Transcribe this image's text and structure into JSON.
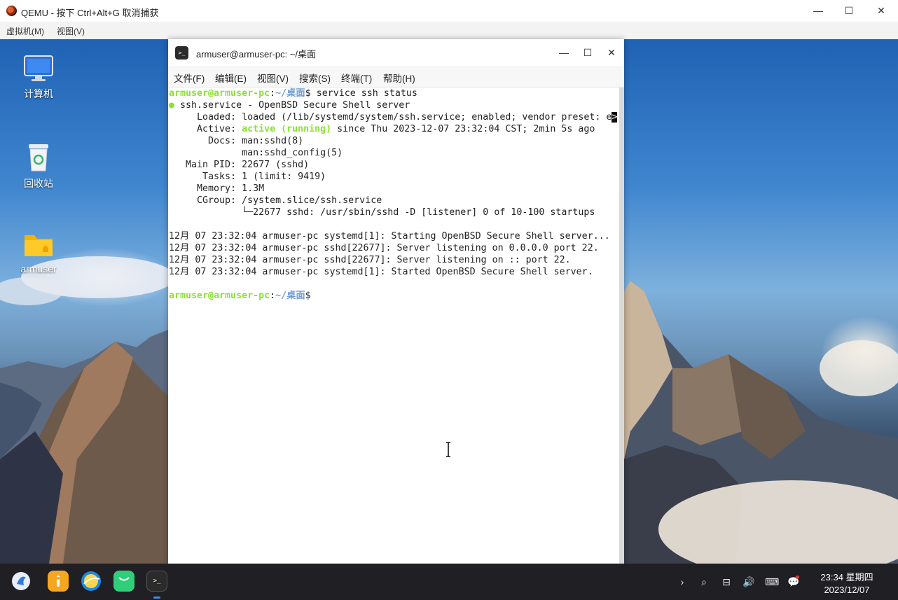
{
  "host": {
    "title": "QEMU - 按下 Ctrl+Alt+G 取消捕获",
    "menu": [
      "虚拟机(M)",
      "视图(V)"
    ],
    "controls": {
      "minimize": "—",
      "maximize": "☐",
      "close": "✕"
    }
  },
  "desktop": {
    "icons": [
      {
        "label": "计算机",
        "icon": "computer-icon"
      },
      {
        "label": "回收站",
        "icon": "trash-icon"
      },
      {
        "label": "armuser",
        "icon": "home-folder-icon"
      }
    ]
  },
  "terminal": {
    "title": "armuser@armuser-pc: ~/桌面",
    "icon_text": ">_",
    "menu": [
      "文件(F)",
      "编辑(E)",
      "视图(V)",
      "搜索(S)",
      "终端(T)",
      "帮助(H)"
    ],
    "prompt_user": "armuser@armuser-pc",
    "prompt_sep": ":",
    "prompt_path": "~/桌面",
    "prompt_end": "$",
    "command": " service ssh status",
    "lines": {
      "service_bullet": "●",
      "service": " ssh.service - OpenBSD Secure Shell server",
      "loaded": "     Loaded: loaded (/lib/systemd/system/ssh.service; enabled; vendor preset: e",
      "loaded_more": ">",
      "active_label": "     Active: ",
      "active_state": "active (running)",
      "active_rest": " since Thu 2023-12-07 23:32:04 CST; 2min 5s ago",
      "docs1": "       Docs: man:sshd(8)",
      "docs2": "             man:sshd_config(5)",
      "mainpid": "   Main PID: 22677 (sshd)",
      "tasks": "      Tasks: 1 (limit: 9419)",
      "memory": "     Memory: 1.3M",
      "cgroup": "     CGroup: /system.slice/ssh.service",
      "cgroup_child": "             └─22677 sshd: /usr/sbin/sshd -D [listener] 0 of 10-100 startups",
      "log1": "12月 07 23:32:04 armuser-pc systemd[1]: Starting OpenBSD Secure Shell server...",
      "log2": "12月 07 23:32:04 armuser-pc sshd[22677]: Server listening on 0.0.0.0 port 22.",
      "log3": "12月 07 23:32:04 armuser-pc sshd[22677]: Server listening on :: port 22.",
      "log4": "12月 07 23:32:04 armuser-pc systemd[1]: Started OpenBSD Secure Shell server."
    },
    "controls": {
      "minimize": "—",
      "maximize": "☐",
      "close": "✕"
    }
  },
  "taskbar": {
    "apps": [
      "launcher-icon",
      "app-store-icon",
      "browser-icon",
      "chat-icon",
      "terminal-icon"
    ],
    "terminal_icon_text": ">_",
    "tray": {
      "expand": "›",
      "search": "⌕",
      "network": "⊟",
      "volume": "🔊",
      "keyboard": "⌨",
      "notifications": "💬"
    },
    "clock_time": "23:34 星期四",
    "clock_date": "2023/12/07"
  },
  "colors": {
    "prompt_user": "#8ae234",
    "prompt_path": "#729fcf",
    "taskbar": "#1f1f24",
    "accent": "#3c8cf0"
  }
}
